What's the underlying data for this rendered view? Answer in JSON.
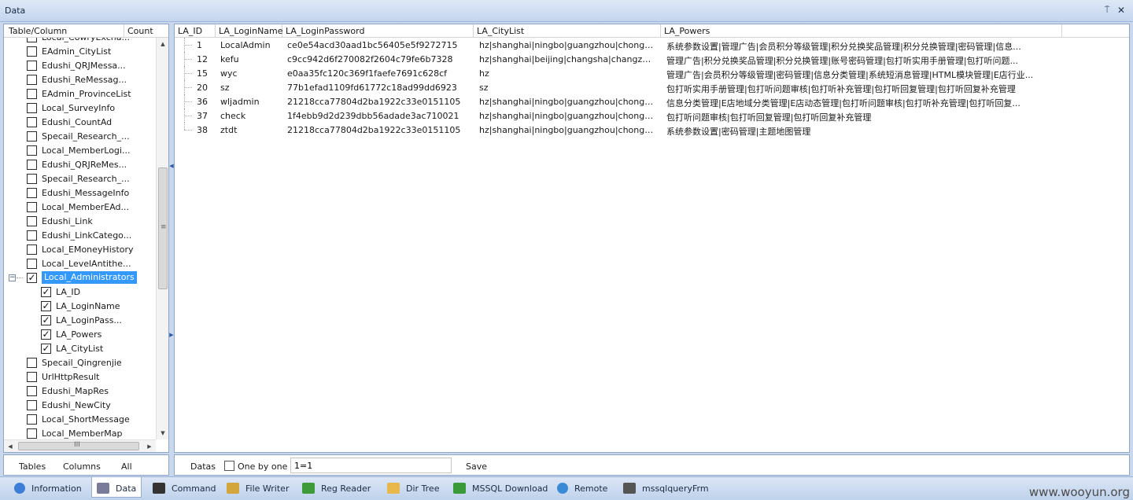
{
  "window": {
    "title": "Data",
    "pin_glyph": "⍑",
    "close_glyph": "✕"
  },
  "tree": {
    "header": {
      "col1": "Table/Column",
      "col2": "Count"
    },
    "items": [
      {
        "label": "Local_CowryExcha...",
        "checked": false,
        "depth": 0
      },
      {
        "label": "EAdmin_CityList",
        "checked": false,
        "depth": 0
      },
      {
        "label": "Edushi_QRJMessa...",
        "checked": false,
        "depth": 0
      },
      {
        "label": "Edushi_ReMessag...",
        "checked": false,
        "depth": 0
      },
      {
        "label": "EAdmin_ProvinceList",
        "checked": false,
        "depth": 0
      },
      {
        "label": "Local_SurveyInfo",
        "checked": false,
        "depth": 0
      },
      {
        "label": "Edushi_CountAd",
        "checked": false,
        "depth": 0
      },
      {
        "label": "Specail_Research_...",
        "checked": false,
        "depth": 0
      },
      {
        "label": "Local_MemberLogi...",
        "checked": false,
        "depth": 0
      },
      {
        "label": "Edushi_QRJReMes...",
        "checked": false,
        "depth": 0
      },
      {
        "label": "Specail_Research_...",
        "checked": false,
        "depth": 0
      },
      {
        "label": "Edushi_MessageInfo",
        "checked": false,
        "depth": 0
      },
      {
        "label": "Local_MemberEAd...",
        "checked": false,
        "depth": 0
      },
      {
        "label": "Edushi_Link",
        "checked": false,
        "depth": 0
      },
      {
        "label": "Edushi_LinkCatego...",
        "checked": false,
        "depth": 0
      },
      {
        "label": "Local_EMoneyHistory",
        "checked": false,
        "depth": 0
      },
      {
        "label": "Local_LevelAntithe...",
        "checked": false,
        "depth": 0
      },
      {
        "label": "Local_Administrators",
        "checked": true,
        "depth": 0,
        "selected": true,
        "expanded": true
      },
      {
        "label": "LA_ID",
        "checked": true,
        "depth": 1
      },
      {
        "label": "LA_LoginName",
        "checked": true,
        "depth": 1
      },
      {
        "label": "LA_LoginPass...",
        "checked": true,
        "depth": 1
      },
      {
        "label": "LA_Powers",
        "checked": true,
        "depth": 1
      },
      {
        "label": "LA_CityList",
        "checked": true,
        "depth": 1
      },
      {
        "label": "Specail_Qingrenjie",
        "checked": false,
        "depth": 0
      },
      {
        "label": "UrlHttpResult",
        "checked": false,
        "depth": 0
      },
      {
        "label": "Edushi_MapRes",
        "checked": false,
        "depth": 0
      },
      {
        "label": "Edushi_NewCity",
        "checked": false,
        "depth": 0
      },
      {
        "label": "Local_ShortMessage",
        "checked": false,
        "depth": 0
      },
      {
        "label": "Local_MemberMap",
        "checked": false,
        "depth": 0
      }
    ],
    "check_glyph": "✓",
    "expander_glyph": "−",
    "vscroll": {
      "up": "▲",
      "down": "▼",
      "grip": "≡"
    },
    "hscroll": {
      "left": "◀",
      "right": "▶",
      "grip": "III"
    }
  },
  "left_footer": {
    "tables": "Tables",
    "columns": "Columns",
    "all": "All"
  },
  "grid": {
    "columns": [
      "LA_ID",
      "LA_LoginName",
      "LA_LoginPassword",
      "LA_CityList",
      "LA_Powers"
    ],
    "rows": [
      [
        "1",
        "LocalAdmin",
        "ce0e54acd30aad1bc56405e5f9272715",
        "hz|shanghai|ningbo|guangzhou|chongqing|...",
        "系统参数设置|管理广告|会员积分等级管理|积分兑换奖品管理|积分兑换管理|密码管理|信息..."
      ],
      [
        "12",
        "kefu",
        "c9cc942d6f270082f2604c79fe6b7328",
        "hz|shanghai|beijing|changsha|changzhou|c...",
        "管理广告|积分兑换奖品管理|积分兑换管理|账号密码管理|包打听实用手册管理|包打听问题..."
      ],
      [
        "15",
        "wyc",
        "e0aa35fc120c369f1faefe7691c628cf",
        "hz",
        "管理广告|会员积分等级管理|密码管理|信息分类管理|系统短消息管理|HTML模块管理|E店行业..."
      ],
      [
        "20",
        "sz",
        "77b1efad1109fd61772c18ad99dd6923",
        "sz",
        "包打听实用手册管理|包打听问题审核|包打听补充管理|包打听回复管理|包打听回复补充管理"
      ],
      [
        "36",
        "wljadmin",
        "21218cca77804d2ba1922c33e0151105",
        "hz|shanghai|ningbo|guangzhou|chongqing|...",
        "信息分类管理|E店地域分类管理|E店动态管理|包打听问题审核|包打听补充管理|包打听回复..."
      ],
      [
        "37",
        "check",
        "1f4ebb9d2d239dbb56adade3ac710021",
        "hz|shanghai|ningbo|guangzhou|chongqing|...",
        "包打听问题审核|包打听回复管理|包打听回复补充管理"
      ],
      [
        "38",
        "ztdt",
        "21218cca77804d2ba1922c33e0151105",
        "hz|shanghai|ningbo|guangzhou|chongqing|...",
        "系统参数设置|密码管理|主题地图管理"
      ]
    ]
  },
  "grid_footer": {
    "datas": "Datas",
    "one_by_one": "One by one",
    "query": "1=1",
    "save": "Save"
  },
  "tabs": [
    {
      "label": "Information",
      "icon": "info-icon",
      "active": false
    },
    {
      "label": "Data",
      "icon": "database-icon",
      "active": true
    },
    {
      "label": "Command",
      "icon": "terminal-icon",
      "active": false
    },
    {
      "label": "File Writer",
      "icon": "pencil-file-icon",
      "active": false
    },
    {
      "label": "Reg Reader",
      "icon": "registry-icon",
      "active": false
    },
    {
      "label": "Dir Tree",
      "icon": "folder-icon",
      "active": false
    },
    {
      "label": "MSSQL Download",
      "icon": "download-icon",
      "active": false
    },
    {
      "label": "Remote",
      "icon": "globe-icon",
      "active": false
    },
    {
      "label": "mssqlqueryFrm",
      "icon": "sql-icon",
      "active": false
    }
  ],
  "watermark": "www.wooyun.org",
  "colors": {
    "selection": "#3399ff",
    "chrome": "#c9d8ec"
  }
}
